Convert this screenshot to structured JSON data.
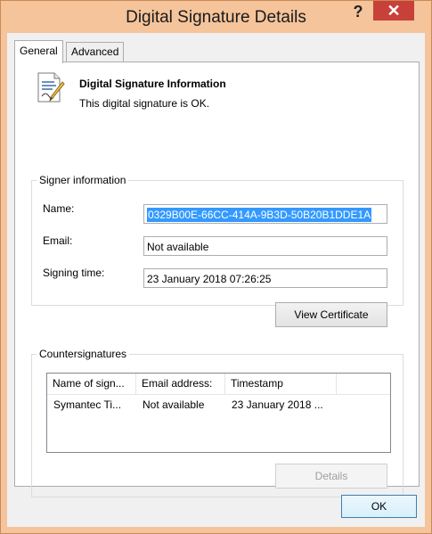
{
  "window": {
    "title": "Digital Signature Details",
    "help_glyph": "?",
    "close_glyph": "✕"
  },
  "tabs": [
    {
      "label": "General",
      "active": true
    },
    {
      "label": "Advanced",
      "active": false
    }
  ],
  "header": {
    "title": "Digital Signature Information",
    "status": "This digital signature is OK.",
    "icon": "certificate-document-icon"
  },
  "signer": {
    "legend": "Signer information",
    "name_label": "Name:",
    "name_value": "0329B00E-66CC-414A-9B3D-50B20B1DDE1A",
    "email_label": "Email:",
    "email_value": "Not available",
    "time_label": "Signing time:",
    "time_value": "23 January 2018 07:26:25",
    "view_cert_button": "View Certificate"
  },
  "countersignatures": {
    "legend": "Countersignatures",
    "columns": [
      "Name of sign...",
      "Email address:",
      "Timestamp"
    ],
    "rows": [
      [
        "Symantec Ti...",
        "Not available",
        "23 January 2018 ..."
      ]
    ],
    "details_button": "Details"
  },
  "footer": {
    "ok_button": "OK"
  },
  "colors": {
    "frame": "#f5c49b",
    "close": "#c7413a",
    "selection": "#3399ff"
  }
}
